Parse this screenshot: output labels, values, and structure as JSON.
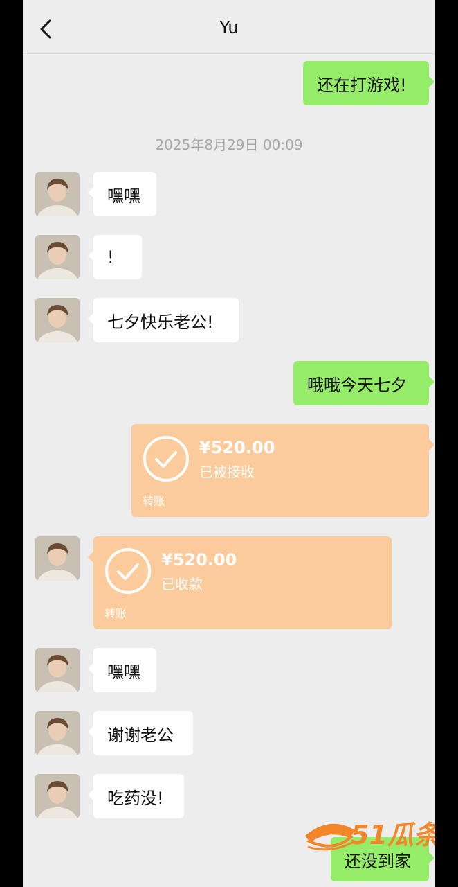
{
  "header": {
    "title": "Yu"
  },
  "timestamp": "2025年8月29日 00:09",
  "messages": [
    {
      "text": "还在打游戏!"
    },
    {
      "text": "嘿嘿"
    },
    {
      "text": "!"
    },
    {
      "text": "七夕快乐老公!"
    },
    {
      "text": "哦哦今天七夕"
    },
    {
      "amount": "¥520.00",
      "status": "已被接收",
      "kind": "转账"
    },
    {
      "amount": "¥520.00",
      "status": "已收款",
      "kind": "转账"
    },
    {
      "text": "嘿嘿"
    },
    {
      "text": "谢谢老公"
    },
    {
      "text": "吃药没!"
    },
    {
      "text": "还没到家"
    }
  ],
  "watermark": {
    "text": "51瓜条"
  },
  "colors": {
    "outgoing": "#95ec69",
    "incoming": "#ffffff",
    "transfer": "#fbcb9b",
    "background": "#ededed"
  },
  "icons": {
    "back": "chevron-left-icon",
    "transfer": "check-circle-icon",
    "watermark": "watermelon-logo-icon"
  }
}
